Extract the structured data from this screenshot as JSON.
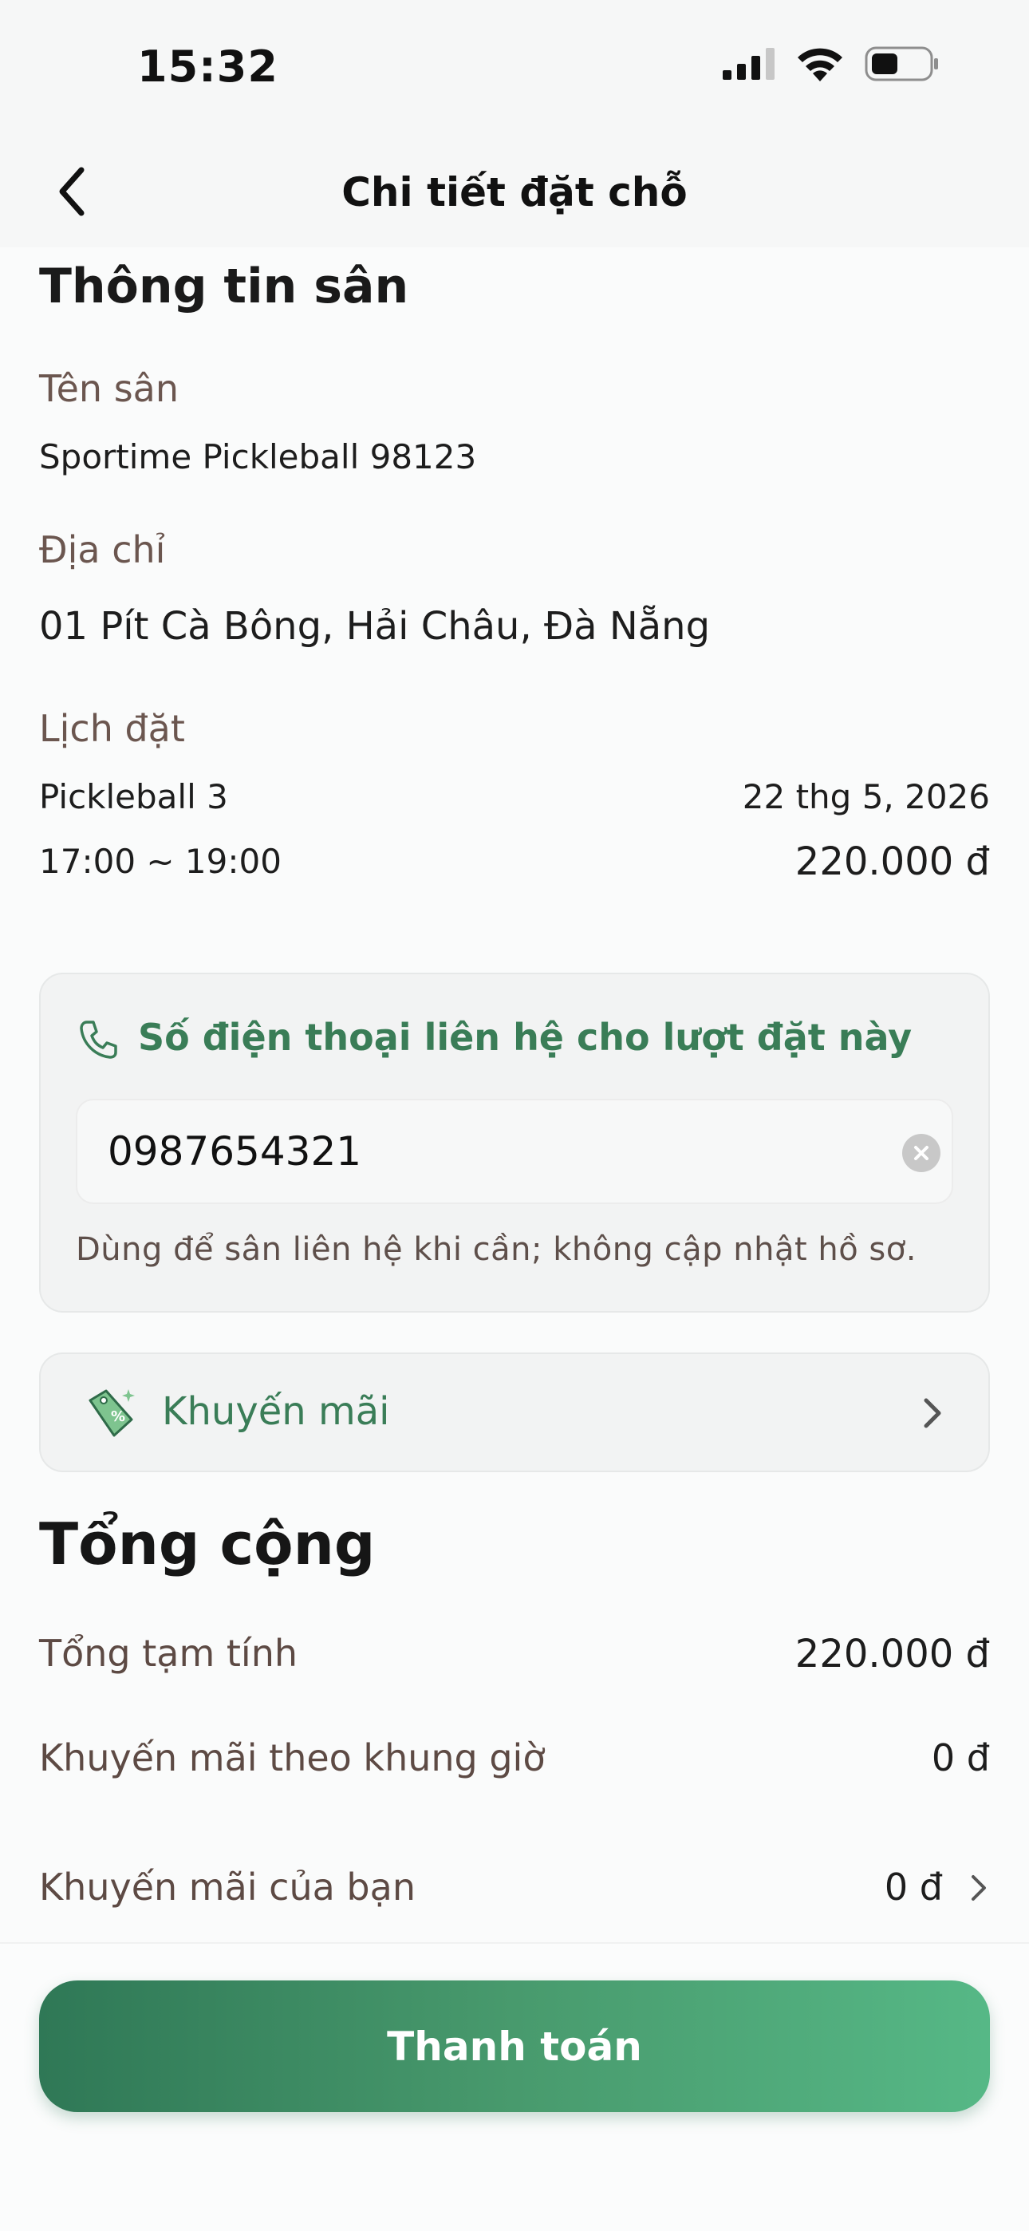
{
  "status_bar": {
    "time": "15:32"
  },
  "nav": {
    "title": "Chi tiết đặt chỗ"
  },
  "court_info": {
    "section_title": "Thông tin sân",
    "name_label": "Tên sân",
    "name_value": "Sportime Pickleball 98123",
    "address_label": "Địa chỉ",
    "address_value": "01 Pít Cà Bông, Hải Châu, Đà Nẵng",
    "schedule_label": "Lịch đặt",
    "court": "Pickleball 3",
    "date": "22 thg 5, 2026",
    "time_range": "17:00 ~ 19:00",
    "price": "220.000 đ"
  },
  "phone_card": {
    "title": "Số điện thoại liên hệ cho lượt đặt này",
    "value": "0987654321",
    "helper": "Dùng để sân liên hệ khi cần; không cập nhật hồ sơ."
  },
  "promo": {
    "label": "Khuyến mãi"
  },
  "totals": {
    "title": "Tổng cộng",
    "rows": [
      {
        "label": "Tổng tạm tính",
        "value": "220.000 đ"
      },
      {
        "label": "Khuyến mãi theo khung giờ",
        "value": "0 đ"
      },
      {
        "label": "Khuyến mãi của bạn",
        "value": "0 đ"
      }
    ]
  },
  "actions": {
    "pay_label": "Thanh toán"
  },
  "colors": {
    "accent": "#3a7d57",
    "label_brown": "#6b564f"
  }
}
